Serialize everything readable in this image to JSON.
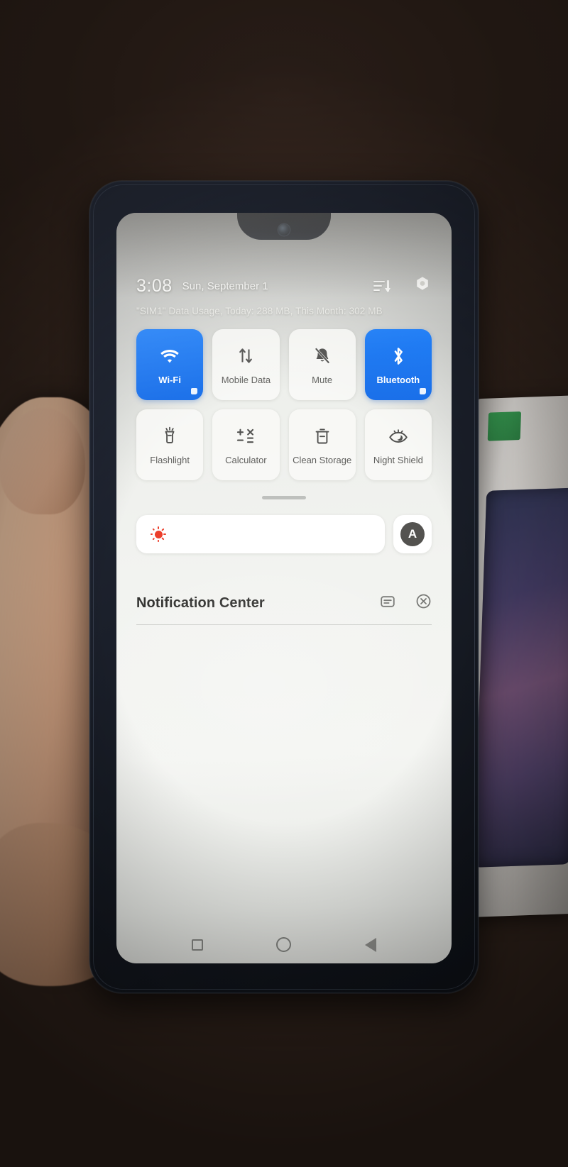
{
  "device": {
    "platform": "Android",
    "surface": "quick-settings-shade"
  },
  "status_bar": {
    "clock": "3:08",
    "date": "Sun, September 1",
    "list_icon": "list-sort-icon",
    "settings_icon": "gear-icon"
  },
  "data_usage": {
    "text": "\"SIM1\" Data Usage, Today: 288 MB, This Month: 302 MB",
    "sim_label": "SIM1",
    "today": "288 MB",
    "this_month": "302 MB"
  },
  "colors": {
    "tile_active": "#1276f5",
    "tile_inactive": "#fafaf8",
    "tile_label_inactive": "#5a5a58",
    "tile_label_active": "#ffffff",
    "brightness_sun": "#ec3a26",
    "auto_circle": "#53524f",
    "nav_icon": "#6c6d6a",
    "screen_bg": "#f2f3f0"
  },
  "tiles": [
    {
      "label": "Wi-Fi",
      "icon": "wifi-icon",
      "active": true,
      "corner_marker": true
    },
    {
      "label": "Mobile Data",
      "icon": "mobile-data-icon",
      "active": false,
      "corner_marker": false
    },
    {
      "label": "Mute",
      "icon": "bell-muted-icon",
      "active": false,
      "corner_marker": false
    },
    {
      "label": "Bluetooth",
      "icon": "bluetooth-icon",
      "active": true,
      "corner_marker": true
    },
    {
      "label": "Flashlight",
      "icon": "flashlight-icon",
      "active": false,
      "corner_marker": false
    },
    {
      "label": "Calculator",
      "icon": "calculator-icon",
      "active": false,
      "corner_marker": false
    },
    {
      "label": "Clean Storage",
      "icon": "trash-clean-icon",
      "active": false,
      "corner_marker": false
    },
    {
      "label": "Night Shield",
      "icon": "night-eye-icon",
      "active": false,
      "corner_marker": false
    }
  ],
  "brightness": {
    "icon": "brightness-sun-icon",
    "fill_percent": 0,
    "auto_label": "A",
    "auto_icon": "auto-brightness-icon"
  },
  "drag_handle": {
    "name": "shade-drag-handle"
  },
  "notification_center": {
    "title": "Notification Center",
    "settings_icon": "notification-settings-icon",
    "clear_all_icon": "clear-all-icon",
    "notifications": []
  },
  "nav_bar": {
    "recents_icon": "square-recents-icon",
    "home_icon": "circle-home-icon",
    "back_icon": "triangle-back-icon"
  }
}
